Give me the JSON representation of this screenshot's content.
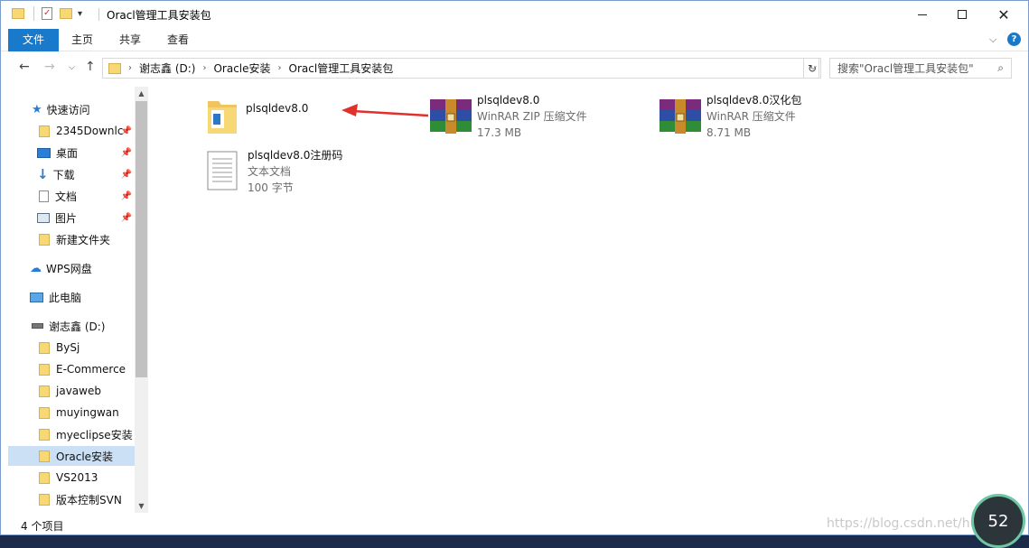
{
  "window": {
    "title": "Oracl管理工具安装包",
    "quick_access_sep": "▾"
  },
  "ribbon": {
    "tabs": [
      "文件",
      "主页",
      "共享",
      "查看"
    ],
    "expand_label": "⌵",
    "help_label": "?"
  },
  "address": {
    "crumbs": [
      "谢志鑫 (D:)",
      "Oracle安装",
      "Oracl管理工具安装包"
    ],
    "search_placeholder": "搜索\"Oracl管理工具安装包\""
  },
  "sidebar": {
    "items": [
      {
        "label": "快速访问",
        "icon": "star-icon"
      },
      {
        "label": "2345Downlc",
        "icon": "folder-icon",
        "pinned": true
      },
      {
        "label": "桌面",
        "icon": "desktop-icon",
        "pinned": true
      },
      {
        "label": "下载",
        "icon": "download-icon",
        "pinned": true
      },
      {
        "label": "文档",
        "icon": "document-icon",
        "pinned": true
      },
      {
        "label": "图片",
        "icon": "picture-icon",
        "pinned": true
      },
      {
        "label": "新建文件夹",
        "icon": "folder-icon"
      },
      {
        "label": "WPS网盘",
        "icon": "cloud-icon"
      },
      {
        "label": "此电脑",
        "icon": "computer-icon"
      },
      {
        "label": "谢志鑫 (D:)",
        "icon": "drive-icon"
      },
      {
        "label": "BySj",
        "icon": "folder-icon"
      },
      {
        "label": "E-Commerce",
        "icon": "folder-icon"
      },
      {
        "label": "javaweb",
        "icon": "folder-icon"
      },
      {
        "label": "muyingwan",
        "icon": "folder-icon"
      },
      {
        "label": "myeclipse安装",
        "icon": "folder-icon"
      },
      {
        "label": "Oracle安装",
        "icon": "folder-icon",
        "selected": true
      },
      {
        "label": "VS2013",
        "icon": "folder-icon"
      },
      {
        "label": "版本控制SVN",
        "icon": "folder-icon"
      }
    ]
  },
  "files": [
    {
      "name": "plsqldev8.0",
      "type": "",
      "size": "",
      "icon": "folder-icon"
    },
    {
      "name": "plsqldev8.0",
      "type": "WinRAR ZIP 压缩文件",
      "size": "17.3 MB",
      "icon": "winrar-icon"
    },
    {
      "name": "plsqldev8.0汉化包",
      "type": "WinRAR 压缩文件",
      "size": "8.71 MB",
      "icon": "winrar-icon"
    },
    {
      "name": "plsqldev8.0注册码",
      "type": "文本文档",
      "size": "100 字节",
      "icon": "text-file-icon"
    }
  ],
  "status": {
    "count": "4 个项目"
  },
  "overlay": {
    "watermark": "https://blog.csdn.net/huan",
    "speed": "52"
  },
  "colors": {
    "accent": "#1979ca",
    "selected": "#cce0f5",
    "folder": "#f8d775",
    "arrow": "#e0312b"
  }
}
